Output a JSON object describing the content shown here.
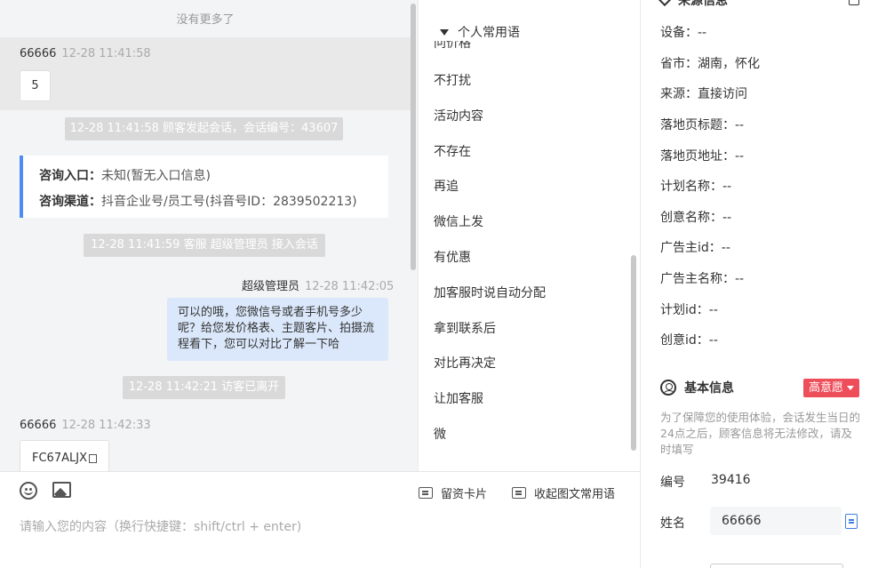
{
  "chat": {
    "no_more": "没有更多了",
    "messages": [
      {
        "sender": "66666",
        "time": "12-28 11:41:58",
        "content": "5"
      },
      {
        "sender": "超级管理员",
        "time": "12-28 11:42:05",
        "content": "可以的哦，您微信号或者手机号多少呢？给您发价格表、主题客片、拍摄流程看下，您可以对比了解一下哈"
      },
      {
        "sender": "66666",
        "time": "12-28 11:42:33",
        "content": "FC67ALJX"
      }
    ],
    "system": [
      "12-28 11:41:58 顾客发起会话，会话编号：43607",
      "12-28 11:41:59 客服 超级管理员 接入会话",
      "12-28 11:42:21 访客已离开"
    ],
    "info_card": {
      "entry_label": "咨询入口：",
      "entry_value": "未知(暂无入口信息)",
      "channel_label": "咨询渠道：",
      "channel_value": "抖音企业号/员工号(抖音号ID：2839502213)"
    }
  },
  "input": {
    "placeholder": "请输入您的内容（换行快捷键：shift/ctrl + enter)",
    "card_button": "留资卡片",
    "collapse_button": "收起图文常用语"
  },
  "phrases": {
    "title": "个人常用语",
    "partial_item": "问价格",
    "items": [
      "不打扰",
      "活动内容",
      "不存在",
      "再追",
      "微信上发",
      "有优惠",
      "加客服时说自动分配",
      "拿到联系后",
      "对比再决定",
      "让加客服",
      "微"
    ]
  },
  "source_info": {
    "section_title": "来源信息",
    "rows": [
      {
        "label": "设备：",
        "value": "--"
      },
      {
        "label": "省市：",
        "value": "湖南，怀化"
      },
      {
        "label": "来源：",
        "value": "直接访问"
      },
      {
        "label": "落地页标题：",
        "value": "--"
      },
      {
        "label": "落地页地址：",
        "value": "--"
      },
      {
        "label": "计划名称：",
        "value": "--"
      },
      {
        "label": "创意名称：",
        "value": "--"
      },
      {
        "label": "广告主id：",
        "value": "--"
      },
      {
        "label": "广告主名称：",
        "value": "--"
      },
      {
        "label": "计划id：",
        "value": "--"
      },
      {
        "label": "创意id：",
        "value": "--"
      }
    ]
  },
  "basic_info": {
    "title": "基本信息",
    "intent_badge": "高意愿",
    "notice": "为了保障您的使用体验，会话发生当日的24点之后，顾客信息将无法修改，请及时填写",
    "id_label": "编号",
    "id_value": "39416",
    "name_label": "姓名",
    "name_value": "66666"
  },
  "colors": {
    "accent_blue": "#4e8cf5",
    "bubble_blue": "#dbe8fb",
    "badge_red": "#ee4d5a"
  }
}
